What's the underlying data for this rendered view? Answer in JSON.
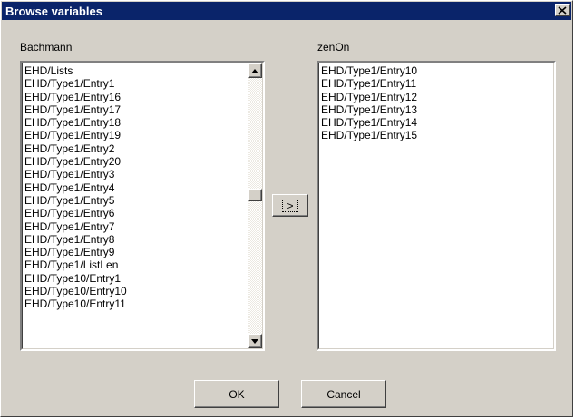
{
  "window": {
    "title": "Browse variables",
    "close_glyph": "×"
  },
  "left": {
    "label": "Bachmann",
    "items": [
      "EHD/Lists",
      "EHD/Type1/Entry1",
      "EHD/Type1/Entry16",
      "EHD/Type1/Entry17",
      "EHD/Type1/Entry18",
      "EHD/Type1/Entry19",
      "EHD/Type1/Entry2",
      "EHD/Type1/Entry20",
      "EHD/Type1/Entry3",
      "EHD/Type1/Entry4",
      "EHD/Type1/Entry5",
      "EHD/Type1/Entry6",
      "EHD/Type1/Entry7",
      "EHD/Type1/Entry8",
      "EHD/Type1/Entry9",
      "EHD/Type1/ListLen",
      "EHD/Type10/Entry1",
      "EHD/Type10/Entry10",
      "EHD/Type10/Entry11"
    ],
    "scroll_position": 0.45
  },
  "right": {
    "label": "zenOn",
    "items": [
      "EHD/Type1/Entry10",
      "EHD/Type1/Entry11",
      "EHD/Type1/Entry12",
      "EHD/Type1/Entry13",
      "EHD/Type1/Entry14",
      "EHD/Type1/Entry15"
    ]
  },
  "move_button": {
    "label": ">"
  },
  "buttons": {
    "ok": "OK",
    "cancel": "Cancel"
  },
  "colors": {
    "titlebar": "#0a246a",
    "face": "#d4d0c8"
  }
}
